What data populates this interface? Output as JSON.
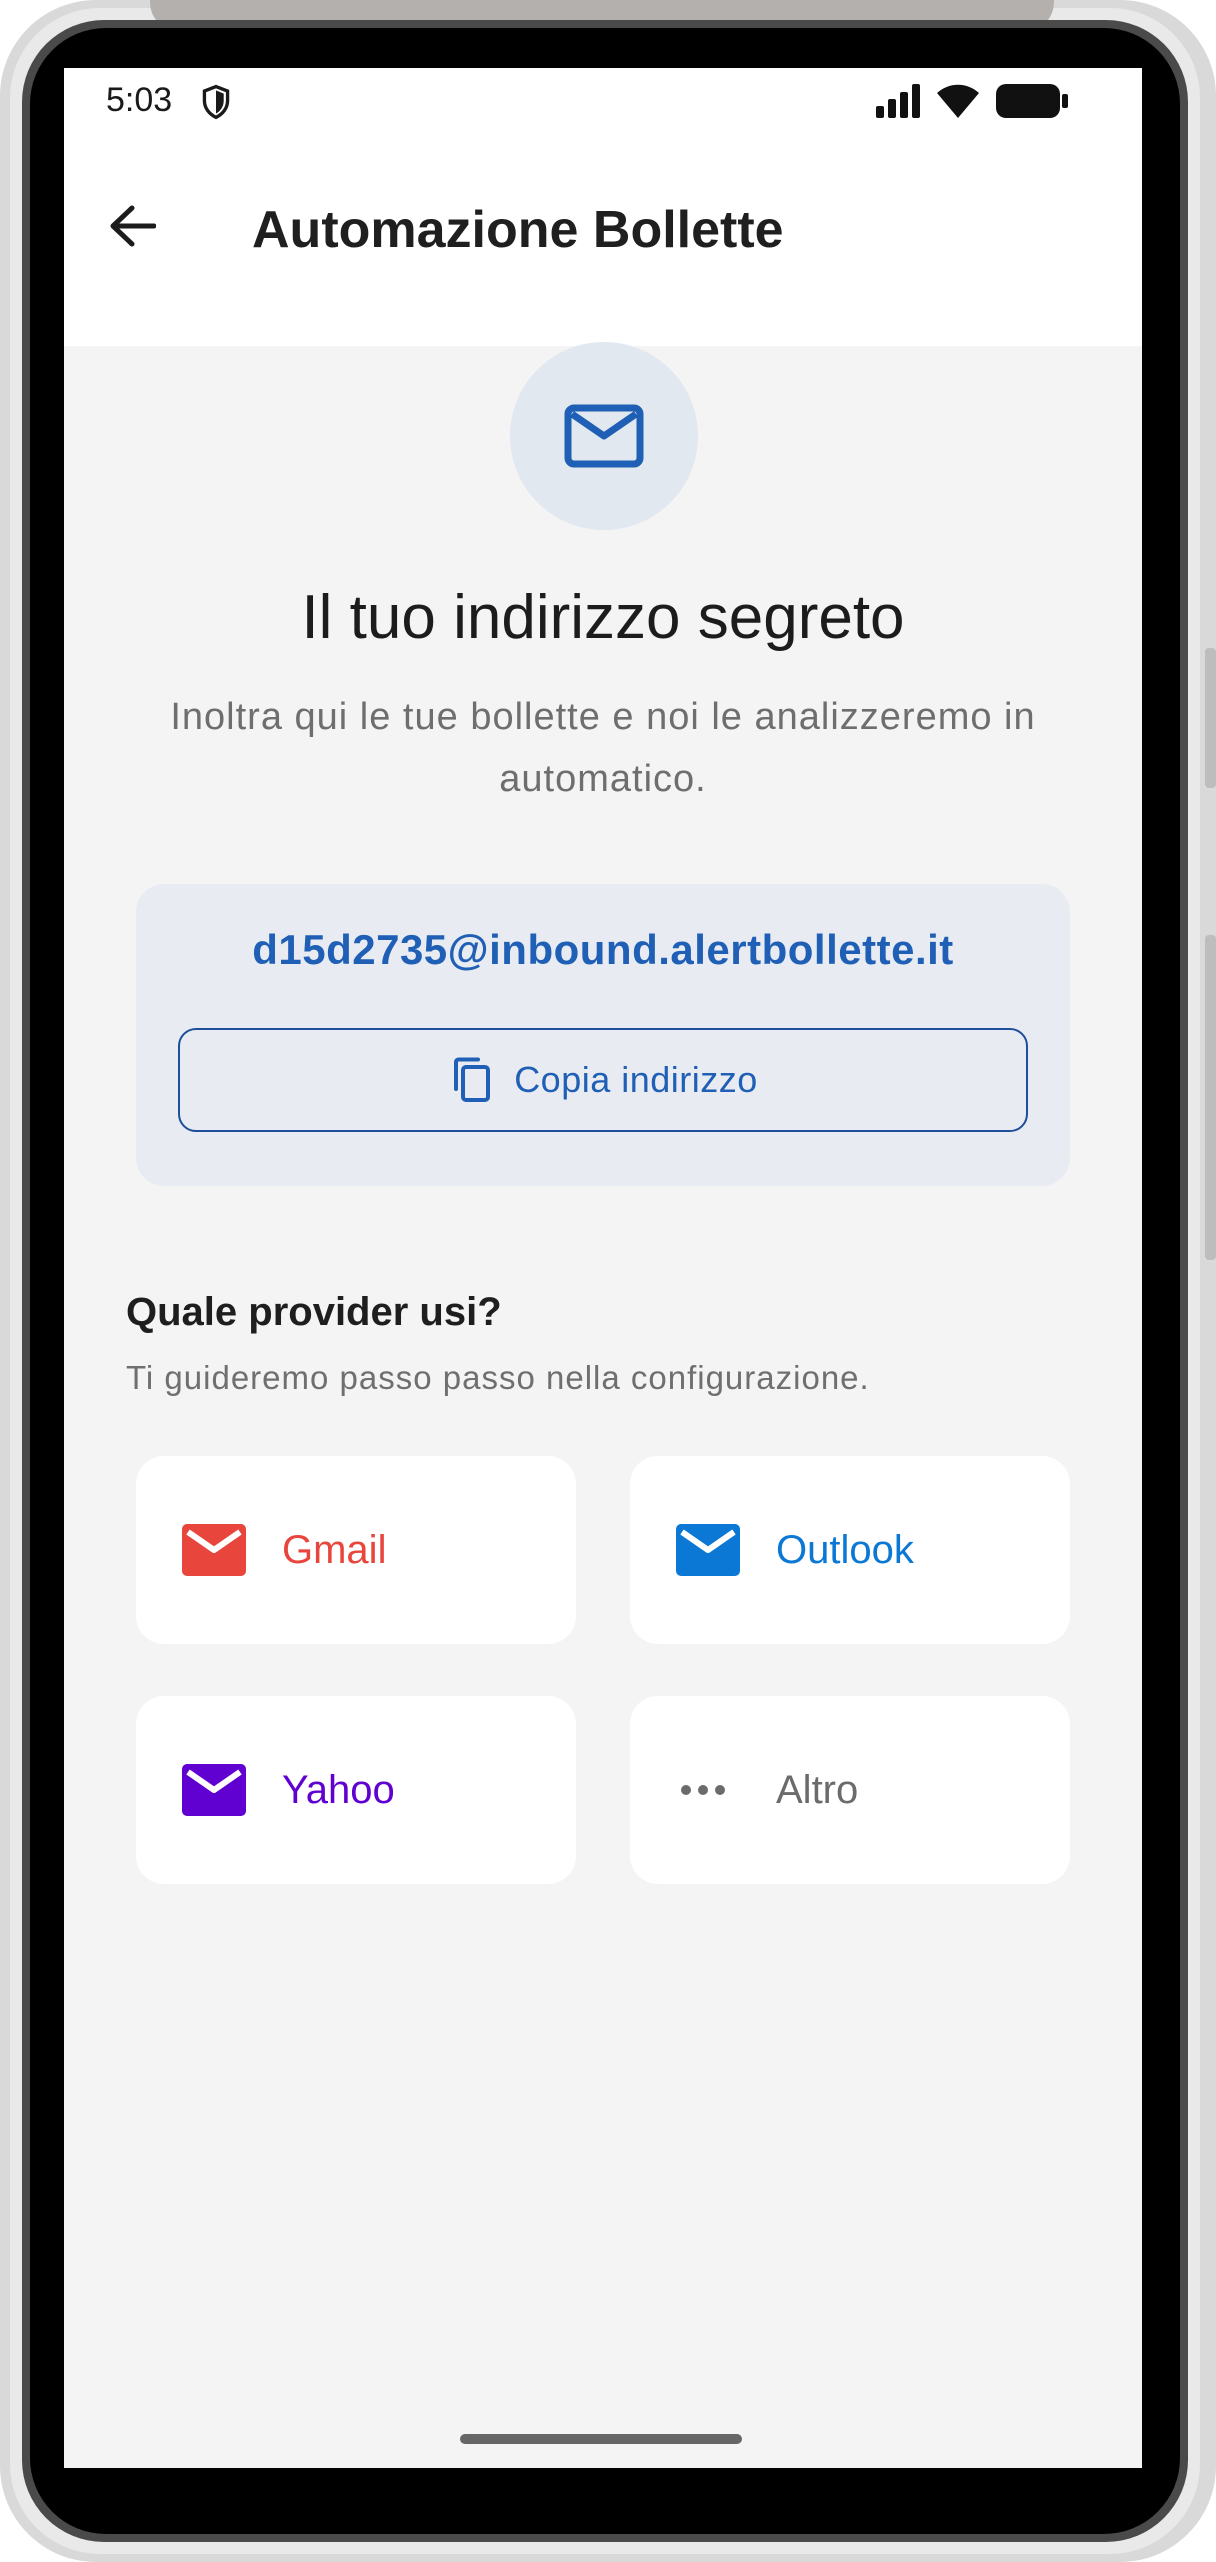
{
  "status_bar": {
    "time": "5:03",
    "icons": [
      "shield-icon",
      "signal-icon",
      "wifi-icon",
      "battery-icon"
    ]
  },
  "app_bar": {
    "title": "Automazione Bollette",
    "back_icon": "arrow-left-icon"
  },
  "hero": {
    "icon": "mail-icon",
    "title": "Il tuo indirizzo segreto",
    "subtitle": "Inoltra qui le tue bollette e noi le analizzeremo in automatico."
  },
  "address_card": {
    "address": "d15d2735@inbound.alertbollette.it",
    "copy_label": "Copia indirizzo",
    "copy_icon": "copy-icon"
  },
  "providers": {
    "title": "Quale provider usi?",
    "subtitle": "Ti guideremo passo passo nella configurazione.",
    "items": [
      {
        "label": "Gmail",
        "icon": "mail-icon",
        "color": "#e8453c"
      },
      {
        "label": "Outlook",
        "icon": "mail-icon",
        "color": "#0a78d4"
      },
      {
        "label": "Yahoo",
        "icon": "mail-icon",
        "color": "#6001d2"
      },
      {
        "label": "Altro",
        "icon": "more-horizontal-icon",
        "color": "#6b6b6b"
      }
    ]
  },
  "colors": {
    "primary": "#1f5fb5",
    "background": "#f4f4f4",
    "card": "#e8ecf2"
  }
}
